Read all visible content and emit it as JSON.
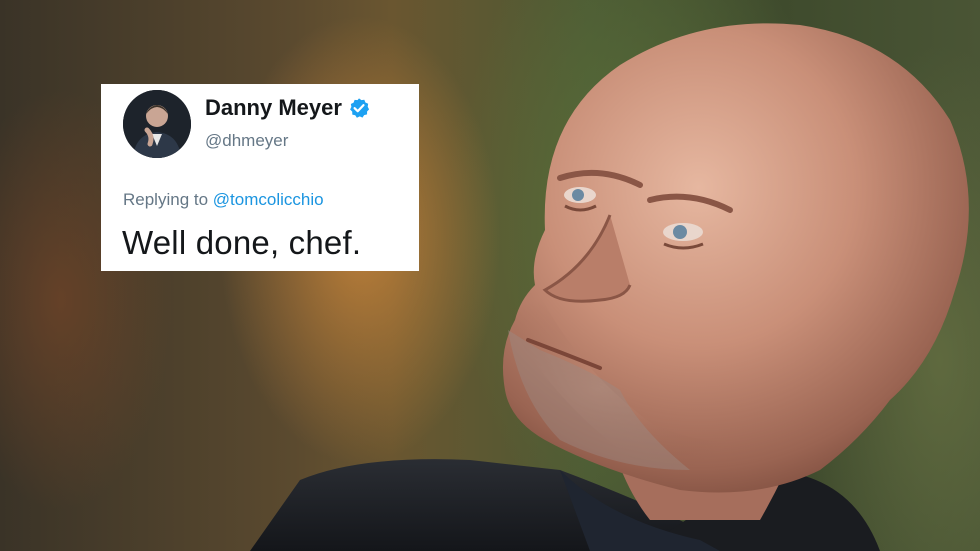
{
  "tweet": {
    "display_name": "Danny Meyer",
    "handle": "@dhmeyer",
    "verified": true,
    "replying_prefix": "Replying to",
    "replying_to": "@tomcolicchio",
    "text": "Well done, chef."
  },
  "photo": {
    "subject": "bald man in dark jacket looking up",
    "background": "blurred warm and green restaurant interior"
  },
  "icons": {
    "verified": "verified-badge-icon",
    "avatar": "profile-avatar"
  },
  "colors": {
    "link_blue": "#1b95e0",
    "verified_blue": "#1da1f2",
    "muted_text": "#657786",
    "tweet_text": "#14171a",
    "card_bg": "#ffffff"
  }
}
